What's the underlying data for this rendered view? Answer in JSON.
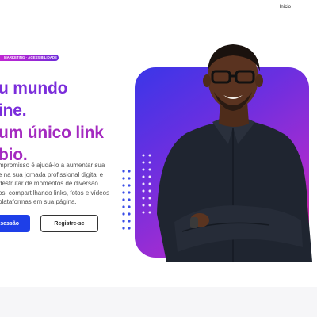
{
  "nav": {
    "home_link": "Início"
  },
  "hero": {
    "tag": "MARKETING · ACESSIBILIDADE",
    "headline_lines": [
      "u mundo",
      "ine.",
      "um único link",
      "bio."
    ],
    "description_lines": [
      "mpromisso é ajudá-lo a aumentar sua",
      "e na sua jornada profissional digital e",
      "desfrutar de momentos de diversão",
      "os, compartilhando links, fotos e vídeos",
      "plataformas em sua página."
    ],
    "primary_button": "ssessão",
    "secondary_button": "Registre-se"
  },
  "colors": {
    "brand_purple": "#7b2ddb",
    "brand_blue": "#1e3fe8",
    "gradient_start": "#3a36e8",
    "gradient_end": "#e0207f"
  }
}
